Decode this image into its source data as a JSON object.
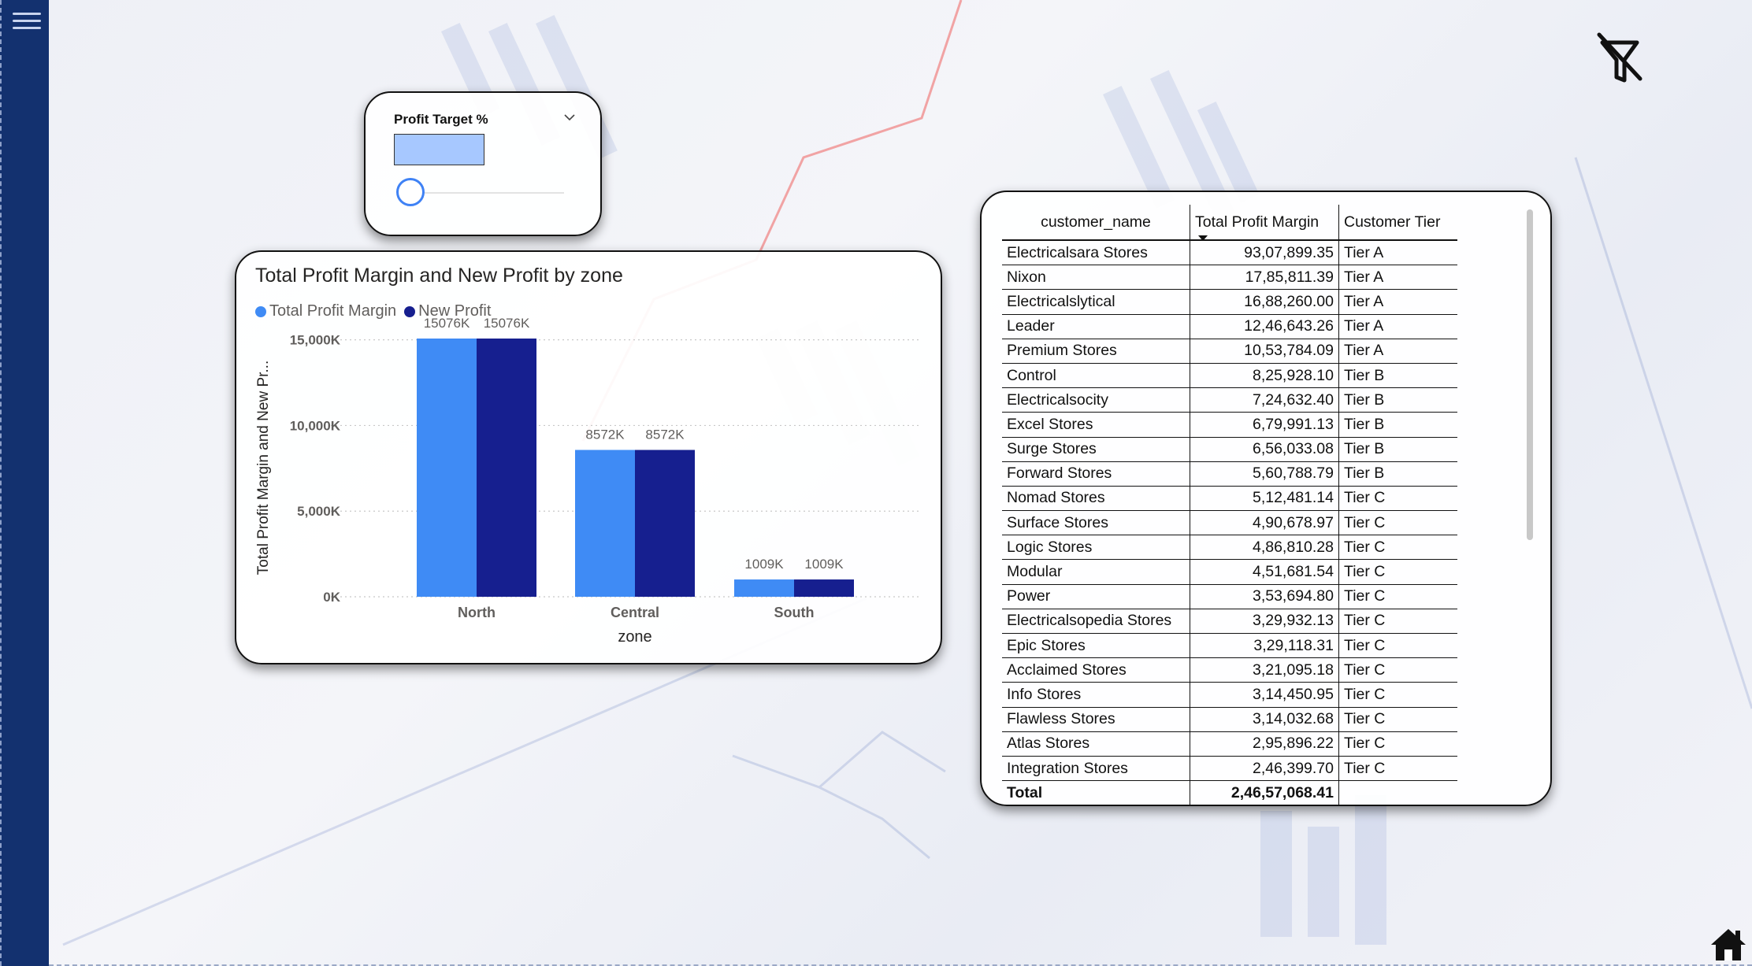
{
  "background": {
    "rail_color": "#13316f"
  },
  "icons": {
    "menu": "hamburger-menu-icon",
    "filter": "filter-clear-icon",
    "home": "home-icon",
    "dropdown": "chevron-down-icon"
  },
  "slicer": {
    "title": "Profit Target %",
    "value_fill": "#a7c8ff"
  },
  "chart": {
    "title": "Total Profit Margin and New Profit by zone",
    "legend": [
      {
        "label": "Total Profit Margin",
        "color": "#3f8bf5"
      },
      {
        "label": "New Profit",
        "color": "#161f8f"
      }
    ]
  },
  "chart_data": {
    "type": "bar",
    "title": "Total Profit Margin and New Profit by zone",
    "xlabel": "zone",
    "ylabel": "Total Profit Margin and New Pr...",
    "categories": [
      "North",
      "Central",
      "South"
    ],
    "series": [
      {
        "name": "Total Profit Margin",
        "values": [
          15076,
          8572,
          1009
        ],
        "color": "#3f8bf5"
      },
      {
        "name": "New Profit",
        "values": [
          15076,
          8572,
          1009
        ],
        "color": "#161f8f"
      }
    ],
    "data_labels": [
      [
        "15076K",
        "8572K",
        "1009K"
      ],
      [
        "15076K",
        "8572K",
        "1009K"
      ]
    ],
    "yticks": [
      {
        "value": 0,
        "label": "0K"
      },
      {
        "value": 5000,
        "label": "5,000K"
      },
      {
        "value": 10000,
        "label": "10,000K"
      },
      {
        "value": 15000,
        "label": "15,000K"
      }
    ],
    "ylim": [
      0,
      15076
    ],
    "grid": true,
    "legend_position": "top-left"
  },
  "table": {
    "headers": [
      "customer_name",
      "Total Profit Margin",
      "Customer Tier"
    ],
    "rows": [
      [
        "Electricalsara Stores",
        "93,07,899.35",
        "Tier A"
      ],
      [
        "Nixon",
        "17,85,811.39",
        "Tier A"
      ],
      [
        "Electricalslytical",
        "16,88,260.00",
        "Tier A"
      ],
      [
        "Leader",
        "12,46,643.26",
        "Tier A"
      ],
      [
        "Premium Stores",
        "10,53,784.09",
        "Tier A"
      ],
      [
        "Control",
        "8,25,928.10",
        "Tier B"
      ],
      [
        "Electricalsocity",
        "7,24,632.40",
        "Tier B"
      ],
      [
        "Excel Stores",
        "6,79,991.13",
        "Tier B"
      ],
      [
        "Surge Stores",
        "6,56,033.08",
        "Tier B"
      ],
      [
        "Forward Stores",
        "5,60,788.79",
        "Tier B"
      ],
      [
        "Nomad Stores",
        "5,12,481.14",
        "Tier C"
      ],
      [
        "Surface Stores",
        "4,90,678.97",
        "Tier C"
      ],
      [
        "Logic Stores",
        "4,86,810.28",
        "Tier C"
      ],
      [
        "Modular",
        "4,51,681.54",
        "Tier C"
      ],
      [
        "Power",
        "3,53,694.80",
        "Tier C"
      ],
      [
        "Electricalsopedia Stores",
        "3,29,932.13",
        "Tier C"
      ],
      [
        "Epic Stores",
        "3,29,118.31",
        "Tier C"
      ],
      [
        "Acclaimed Stores",
        "3,21,095.18",
        "Tier C"
      ],
      [
        "Info Stores",
        "3,14,450.95",
        "Tier C"
      ],
      [
        "Flawless Stores",
        "3,14,032.68",
        "Tier C"
      ],
      [
        "Atlas Stores",
        "2,95,896.22",
        "Tier C"
      ],
      [
        "Integration Stores",
        "2,46,399.70",
        "Tier C"
      ]
    ],
    "total": {
      "label": "Total",
      "value": "2,46,57,068.41",
      "tier": ""
    }
  }
}
